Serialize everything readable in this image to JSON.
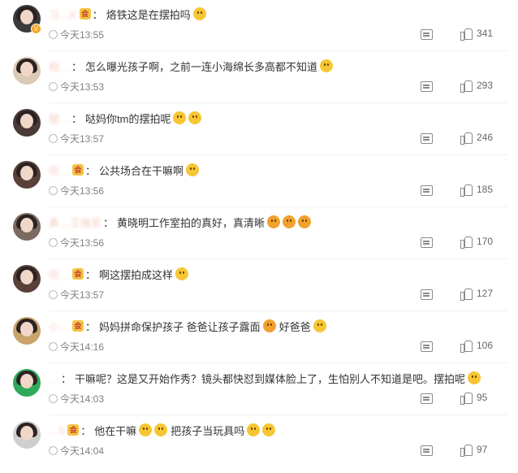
{
  "comments": [
    {
      "username": "习…K",
      "vip": "会",
      "text": "烙铁这是在摆拍吗",
      "emojis": [
        "laugh"
      ],
      "time": "今天13:55",
      "likes": "341",
      "avatar_color": "#3b3b3b",
      "verified": true
    },
    {
      "username": "相…",
      "vip": "",
      "text": "怎么曝光孩子啊，之前一连小海绵长多高都不知道",
      "emojis": [
        "smile"
      ],
      "time": "今天13:53",
      "likes": "293",
      "avatar_color": "#d9c9b5",
      "verified": false
    },
    {
      "username": "楷…",
      "vip": "",
      "text": "哒妈你tm的摆拍呢",
      "emojis": [
        "smile",
        "smile"
      ],
      "time": "今天13:57",
      "likes": "246",
      "avatar_color": "#4a3a38",
      "verified": false
    },
    {
      "username": "吃…",
      "vip": "会",
      "text": "公共场合在干嘛啊",
      "emojis": [
        "sleepy"
      ],
      "time": "今天13:56",
      "likes": "185",
      "avatar_color": "#5a4038",
      "verified": false
    },
    {
      "username": "鼻…王维家",
      "vip": "",
      "text": "黄晓明工作室拍的真好，真清晰",
      "emojis": [
        "scared",
        "scared",
        "scared"
      ],
      "time": "今天13:56",
      "likes": "170",
      "avatar_color": "#7a6a60",
      "verified": false
    },
    {
      "username": "吃…",
      "vip": "会",
      "text": "啊这摆拍成这样",
      "emojis": [
        "sweat"
      ],
      "time": "今天13:57",
      "likes": "127",
      "avatar_color": "#5a4038",
      "verified": false
    },
    {
      "username": "小…",
      "vip": "会",
      "text": "妈妈拼命保护孩子 爸爸让孩子露面",
      "emojis": [
        "scared"
      ],
      "after": "好爸爸",
      "after_emojis": [
        "smile"
      ],
      "time": "今天14:16",
      "likes": "106",
      "avatar_color": "#c9a36b",
      "verified": false
    },
    {
      "username": "…",
      "vip": "",
      "text": "干嘛呢？这是又开始作秀？镜头都快怼到媒体脸上了，生怕别人不知道是吧。摆拍呢",
      "emojis": [
        "think"
      ],
      "time": "今天14:03",
      "likes": "95",
      "avatar_color": "#2eaa5a",
      "verified": false
    },
    {
      "username": "…b",
      "vip": "会",
      "text": "他在干嘛",
      "emojis": [
        "sly",
        "sly"
      ],
      "after": "把孩子当玩具吗",
      "after_emojis": [
        "think",
        "think"
      ],
      "time": "今天14:04",
      "likes": "97",
      "avatar_color": "#cfcfcf",
      "verified": false
    }
  ]
}
